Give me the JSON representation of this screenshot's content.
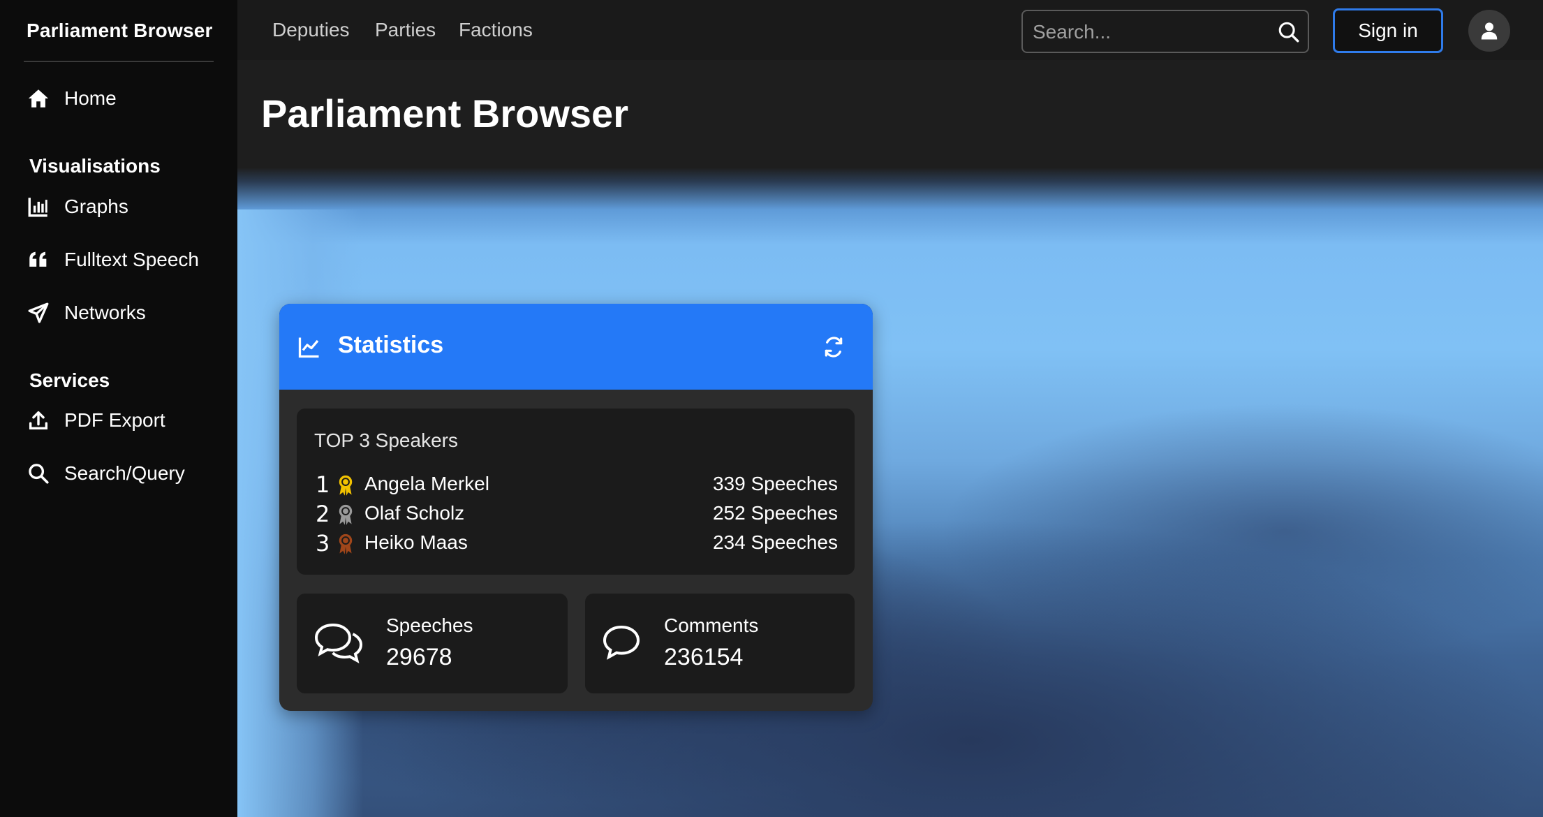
{
  "sidebar": {
    "brand": "Parliament Browser",
    "home_label": "Home",
    "sections": {
      "visualisations": "Visualisations",
      "services": "Services"
    },
    "items": {
      "graphs": "Graphs",
      "fulltext": "Fulltext Speech",
      "networks": "Networks",
      "pdf_export": "PDF Export",
      "search_query": "Search/Query"
    }
  },
  "topbar": {
    "nav": [
      "Deputies",
      "Parties",
      "Factions"
    ],
    "search_placeholder": "Search...",
    "signin_label": "Sign in"
  },
  "main": {
    "page_title": "Parliament Browser"
  },
  "statistics": {
    "title": "Statistics",
    "top_speakers_title": "TOP 3 Speakers",
    "speakers": [
      {
        "rank": "1",
        "name": "Angela Merkel",
        "count": "339 Speeches",
        "medal": "gold"
      },
      {
        "rank": "2",
        "name": "Olaf Scholz",
        "count": "252 Speeches",
        "medal": "silver"
      },
      {
        "rank": "3",
        "name": "Heiko Maas",
        "count": "234 Speeches",
        "medal": "bronze"
      }
    ],
    "speeches_label": "Speeches",
    "speeches_value": "29678",
    "comments_label": "Comments",
    "comments_value": "236154"
  },
  "colors": {
    "accent": "#2479f7",
    "gold": "#f2c200",
    "silver": "#9a9a9a",
    "bronze": "#a0461a"
  }
}
